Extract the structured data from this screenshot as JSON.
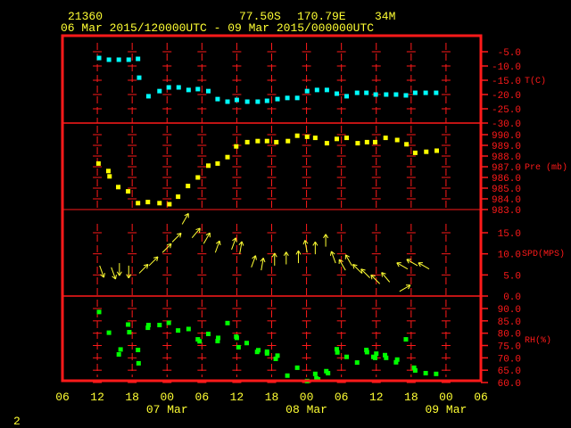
{
  "header": {
    "station": "21360",
    "lat": "77.50S",
    "lon": "170.79E",
    "elev": "34M",
    "period": "06 Mar 2015/120000UTC - 09 Mar 2015/000000UTC"
  },
  "page_number": "2",
  "colors": {
    "frame": "#ff1a1a",
    "text": "#ffff33",
    "temp": "#00ffff",
    "pres": "#ffff00",
    "wind": "#ffff33",
    "rh": "#00ff00"
  },
  "x_axis": {
    "unit": "hours since 06 Mar 06UTC",
    "range": [
      0,
      72
    ],
    "ticks": [
      "06",
      "12",
      "18",
      "00",
      "06",
      "12",
      "18",
      "00",
      "06",
      "12",
      "18",
      "00",
      "06"
    ],
    "dates": [
      {
        "label": "07 Mar",
        "hour": 18
      },
      {
        "label": "08 Mar",
        "hour": 42
      },
      {
        "label": "09 Mar",
        "hour": 66
      }
    ]
  },
  "chart_data": [
    {
      "type": "scatter",
      "label": "T(C)",
      "ylim": [
        -30,
        -5
      ],
      "ticks": [
        "-5.0",
        "-10.0",
        "-15.0",
        "-20.0",
        "-25.0",
        "-30.0"
      ],
      "points": [
        [
          6.3,
          -7.2
        ],
        [
          8.0,
          -7.8
        ],
        [
          9.7,
          -7.8
        ],
        [
          11.4,
          -7.8
        ],
        [
          13.0,
          -7.5
        ],
        [
          13.2,
          -14.1
        ],
        [
          14.8,
          -20.6
        ],
        [
          16.7,
          -18.8
        ],
        [
          18.3,
          -17.5
        ],
        [
          20.0,
          -17.5
        ],
        [
          21.7,
          -18.4
        ],
        [
          23.3,
          -18.1
        ],
        [
          25.1,
          -18.8
        ],
        [
          26.7,
          -21.6
        ],
        [
          28.4,
          -22.5
        ],
        [
          30.0,
          -21.9
        ],
        [
          31.8,
          -22.5
        ],
        [
          33.6,
          -22.5
        ],
        [
          35.2,
          -22.2
        ],
        [
          37.0,
          -21.6
        ],
        [
          38.7,
          -21.2
        ],
        [
          40.4,
          -21.2
        ],
        [
          42.1,
          -18.8
        ],
        [
          43.8,
          -18.4
        ],
        [
          45.5,
          -18.4
        ],
        [
          47.2,
          -19.7
        ],
        [
          48.9,
          -20.6
        ],
        [
          50.7,
          -19.4
        ],
        [
          52.3,
          -19.4
        ],
        [
          53.9,
          -20.0
        ],
        [
          55.7,
          -20.0
        ],
        [
          57.4,
          -20.0
        ],
        [
          59.1,
          -20.3
        ],
        [
          60.7,
          -19.4
        ],
        [
          62.5,
          -19.4
        ],
        [
          64.3,
          -19.4
        ]
      ]
    },
    {
      "type": "scatter",
      "label": "Pre (mb)",
      "ylim": [
        983,
        990
      ],
      "ticks": [
        "990.0",
        "989.0",
        "988.0",
        "987.0",
        "986.0",
        "985.0",
        "984.0",
        "983.0"
      ],
      "points": [
        [
          6.2,
          987.3
        ],
        [
          7.9,
          986.6
        ],
        [
          8.1,
          986.1
        ],
        [
          9.6,
          985.1
        ],
        [
          11.3,
          984.7
        ],
        [
          13.0,
          983.6
        ],
        [
          14.7,
          983.7
        ],
        [
          16.7,
          983.6
        ],
        [
          18.4,
          983.5
        ],
        [
          19.9,
          984.2
        ],
        [
          21.6,
          985.2
        ],
        [
          23.3,
          986.0
        ],
        [
          25.1,
          987.1
        ],
        [
          26.7,
          987.3
        ],
        [
          28.4,
          987.9
        ],
        [
          29.9,
          988.9
        ],
        [
          31.8,
          989.3
        ],
        [
          33.6,
          989.4
        ],
        [
          35.2,
          989.4
        ],
        [
          36.8,
          989.3
        ],
        [
          38.8,
          989.4
        ],
        [
          40.4,
          989.9
        ],
        [
          42.1,
          989.8
        ],
        [
          43.5,
          989.7
        ],
        [
          45.5,
          989.2
        ],
        [
          47.2,
          989.6
        ],
        [
          48.9,
          989.7
        ],
        [
          50.8,
          989.2
        ],
        [
          52.4,
          989.3
        ],
        [
          53.8,
          989.3
        ],
        [
          55.6,
          989.7
        ],
        [
          57.6,
          989.5
        ],
        [
          59.2,
          989.1
        ],
        [
          60.7,
          988.3
        ],
        [
          62.6,
          988.4
        ],
        [
          64.4,
          988.5
        ]
      ]
    },
    {
      "type": "vector",
      "label": "SPD(MPS)",
      "ylim": [
        0,
        17
      ],
      "ticks": [
        "15.0",
        "10.0",
        "5.0",
        "0.0"
      ],
      "tick_values": [
        15,
        10,
        5,
        0
      ],
      "points": [
        [
          6.4,
          7.2,
          160
        ],
        [
          8.4,
          6.8,
          160
        ],
        [
          9.8,
          7.8,
          180
        ],
        [
          11.4,
          7.2,
          180
        ],
        [
          13.2,
          5.4,
          45
        ],
        [
          14.9,
          7.2,
          45
        ],
        [
          17.2,
          10.3,
          45
        ],
        [
          18.9,
          12.8,
          45
        ],
        [
          20.6,
          17.0,
          30
        ],
        [
          22.3,
          13.8,
          40
        ],
        [
          24.3,
          12.4,
          30
        ],
        [
          26.3,
          10.3,
          20
        ],
        [
          29.1,
          11.0,
          20
        ],
        [
          30.5,
          10.0,
          10
        ],
        [
          32.5,
          6.8,
          20
        ],
        [
          34.2,
          6.1,
          10
        ],
        [
          36.5,
          7.2,
          0
        ],
        [
          38.5,
          7.5,
          0
        ],
        [
          40.6,
          7.8,
          0
        ],
        [
          42.1,
          10.3,
          350
        ],
        [
          43.5,
          9.9,
          0
        ],
        [
          45.3,
          11.7,
          0
        ],
        [
          47.0,
          7.8,
          340
        ],
        [
          48.7,
          6.1,
          330
        ],
        [
          49.8,
          7.2,
          330
        ],
        [
          51.5,
          5.4,
          315
        ],
        [
          52.9,
          4.3,
          315
        ],
        [
          54.6,
          2.9,
          315
        ],
        [
          56.3,
          3.3,
          320
        ],
        [
          58.0,
          1.1,
          60
        ],
        [
          59.4,
          6.4,
          300
        ],
        [
          61.1,
          7.2,
          300
        ],
        [
          63.1,
          6.4,
          300
        ]
      ]
    },
    {
      "type": "scatter",
      "label": "RH(%)",
      "ylim": [
        60,
        90
      ],
      "ticks": [
        "90.0",
        "85.0",
        "80.0",
        "75.0",
        "70.0",
        "65.0",
        "60.0"
      ],
      "points": [
        [
          6.3,
          88.6
        ],
        [
          8.0,
          80.2
        ],
        [
          9.7,
          71.4
        ],
        [
          10.0,
          73.4
        ],
        [
          11.3,
          83.5
        ],
        [
          11.5,
          80.4
        ],
        [
          13.0,
          73.2
        ],
        [
          13.1,
          67.8
        ],
        [
          14.7,
          82.2
        ],
        [
          14.8,
          83.3
        ],
        [
          16.7,
          83.3
        ],
        [
          18.3,
          84.2
        ],
        [
          19.9,
          81.1
        ],
        [
          21.7,
          81.7
        ],
        [
          23.3,
          77.5
        ],
        [
          23.6,
          76.7
        ],
        [
          25.1,
          79.7
        ],
        [
          26.7,
          76.8
        ],
        [
          26.8,
          78.1
        ],
        [
          28.4,
          84.1
        ],
        [
          29.9,
          78.6
        ],
        [
          30.0,
          78.1
        ],
        [
          30.3,
          74.3
        ],
        [
          31.7,
          76.0
        ],
        [
          33.5,
          72.4
        ],
        [
          33.7,
          73.1
        ],
        [
          35.2,
          71.8
        ],
        [
          35.2,
          72.5
        ],
        [
          36.7,
          69.6
        ],
        [
          37.0,
          70.9
        ],
        [
          38.7,
          62.8
        ],
        [
          40.4,
          66.0
        ],
        [
          42.1,
          60.6
        ],
        [
          43.5,
          63.5
        ],
        [
          43.7,
          61.7
        ],
        [
          44.0,
          61.3
        ],
        [
          45.4,
          64.6
        ],
        [
          45.7,
          63.8
        ],
        [
          47.2,
          73.5
        ],
        [
          47.3,
          72.2
        ],
        [
          48.9,
          70.4
        ],
        [
          50.7,
          68.1
        ],
        [
          52.3,
          73.2
        ],
        [
          52.4,
          72.3
        ],
        [
          53.5,
          70.4
        ],
        [
          53.8,
          70.0
        ],
        [
          54.0,
          71.7
        ],
        [
          55.5,
          71.1
        ],
        [
          55.7,
          70.0
        ],
        [
          57.4,
          68.2
        ],
        [
          57.6,
          69.3
        ],
        [
          59.1,
          77.5
        ],
        [
          60.5,
          66.0
        ],
        [
          60.7,
          64.9
        ],
        [
          62.5,
          63.8
        ],
        [
          64.3,
          63.5
        ]
      ]
    }
  ]
}
